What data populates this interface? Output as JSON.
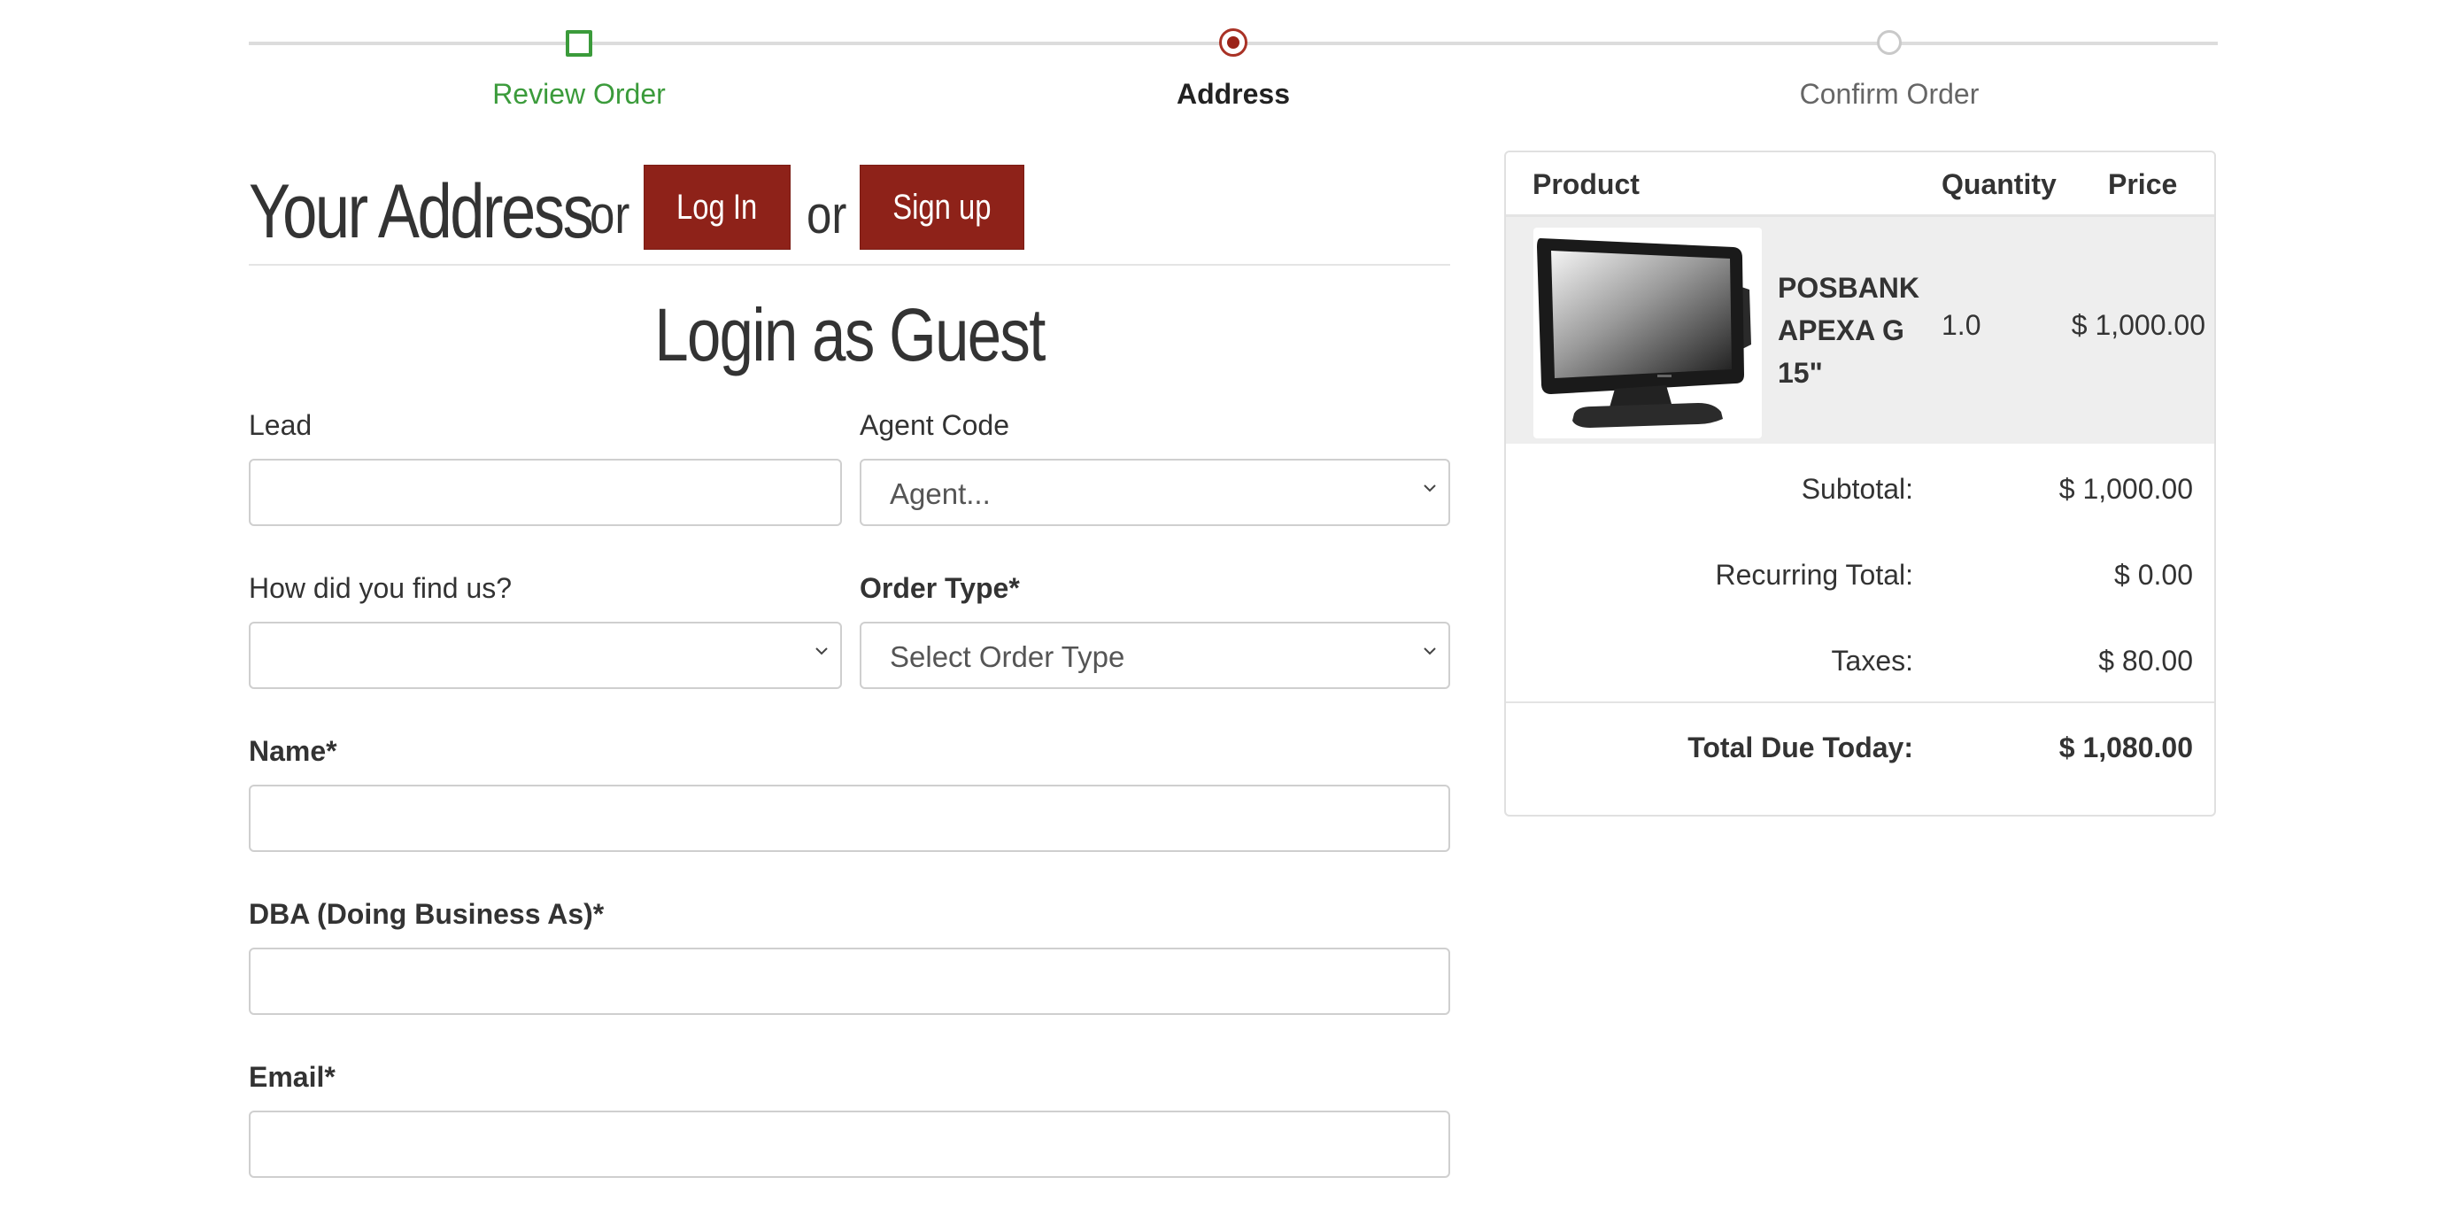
{
  "progress": {
    "steps": [
      {
        "label": "Review Order",
        "state": "done"
      },
      {
        "label": "Address",
        "state": "active"
      },
      {
        "label": "Confirm Order",
        "state": "todo"
      }
    ]
  },
  "header": {
    "title": "Your Address",
    "or_1": "or",
    "login_label": "Log In",
    "or_2": "or",
    "signup_label": "Sign up"
  },
  "guest": {
    "title": "Login as Guest"
  },
  "form": {
    "lead": {
      "label": "Lead",
      "value": ""
    },
    "agent_code": {
      "label": "Agent Code",
      "selected": "Agent..."
    },
    "find_us": {
      "label": "How did you find us?",
      "selected": ""
    },
    "order_type": {
      "label": "Order Type*",
      "selected": "Select Order Type"
    },
    "name": {
      "label": "Name*",
      "value": ""
    },
    "dba": {
      "label": "DBA (Doing Business As)*",
      "value": ""
    },
    "email": {
      "label": "Email*",
      "value": ""
    }
  },
  "summary": {
    "headers": {
      "product": "Product",
      "quantity": "Quantity",
      "price": "Price"
    },
    "items": [
      {
        "name_line1": "POSBANK",
        "name_line2": "APEXA G",
        "name_line3": "15\"",
        "quantity": "1.0",
        "price": "$ 1,000.00",
        "image_icon": "pos-terminal"
      }
    ],
    "subtotal": {
      "label": "Subtotal:",
      "value": "$ 1,000.00"
    },
    "recurring": {
      "label": "Recurring Total:",
      "value": "$ 0.00"
    },
    "taxes": {
      "label": "Taxes:",
      "value": "$ 80.00"
    },
    "total": {
      "label": "Total Due Today:",
      "value": "$ 1,080.00"
    }
  },
  "colors": {
    "accent": "#8e2219",
    "done_green": "#3b9b3b",
    "row_bg": "#eeeeee"
  }
}
